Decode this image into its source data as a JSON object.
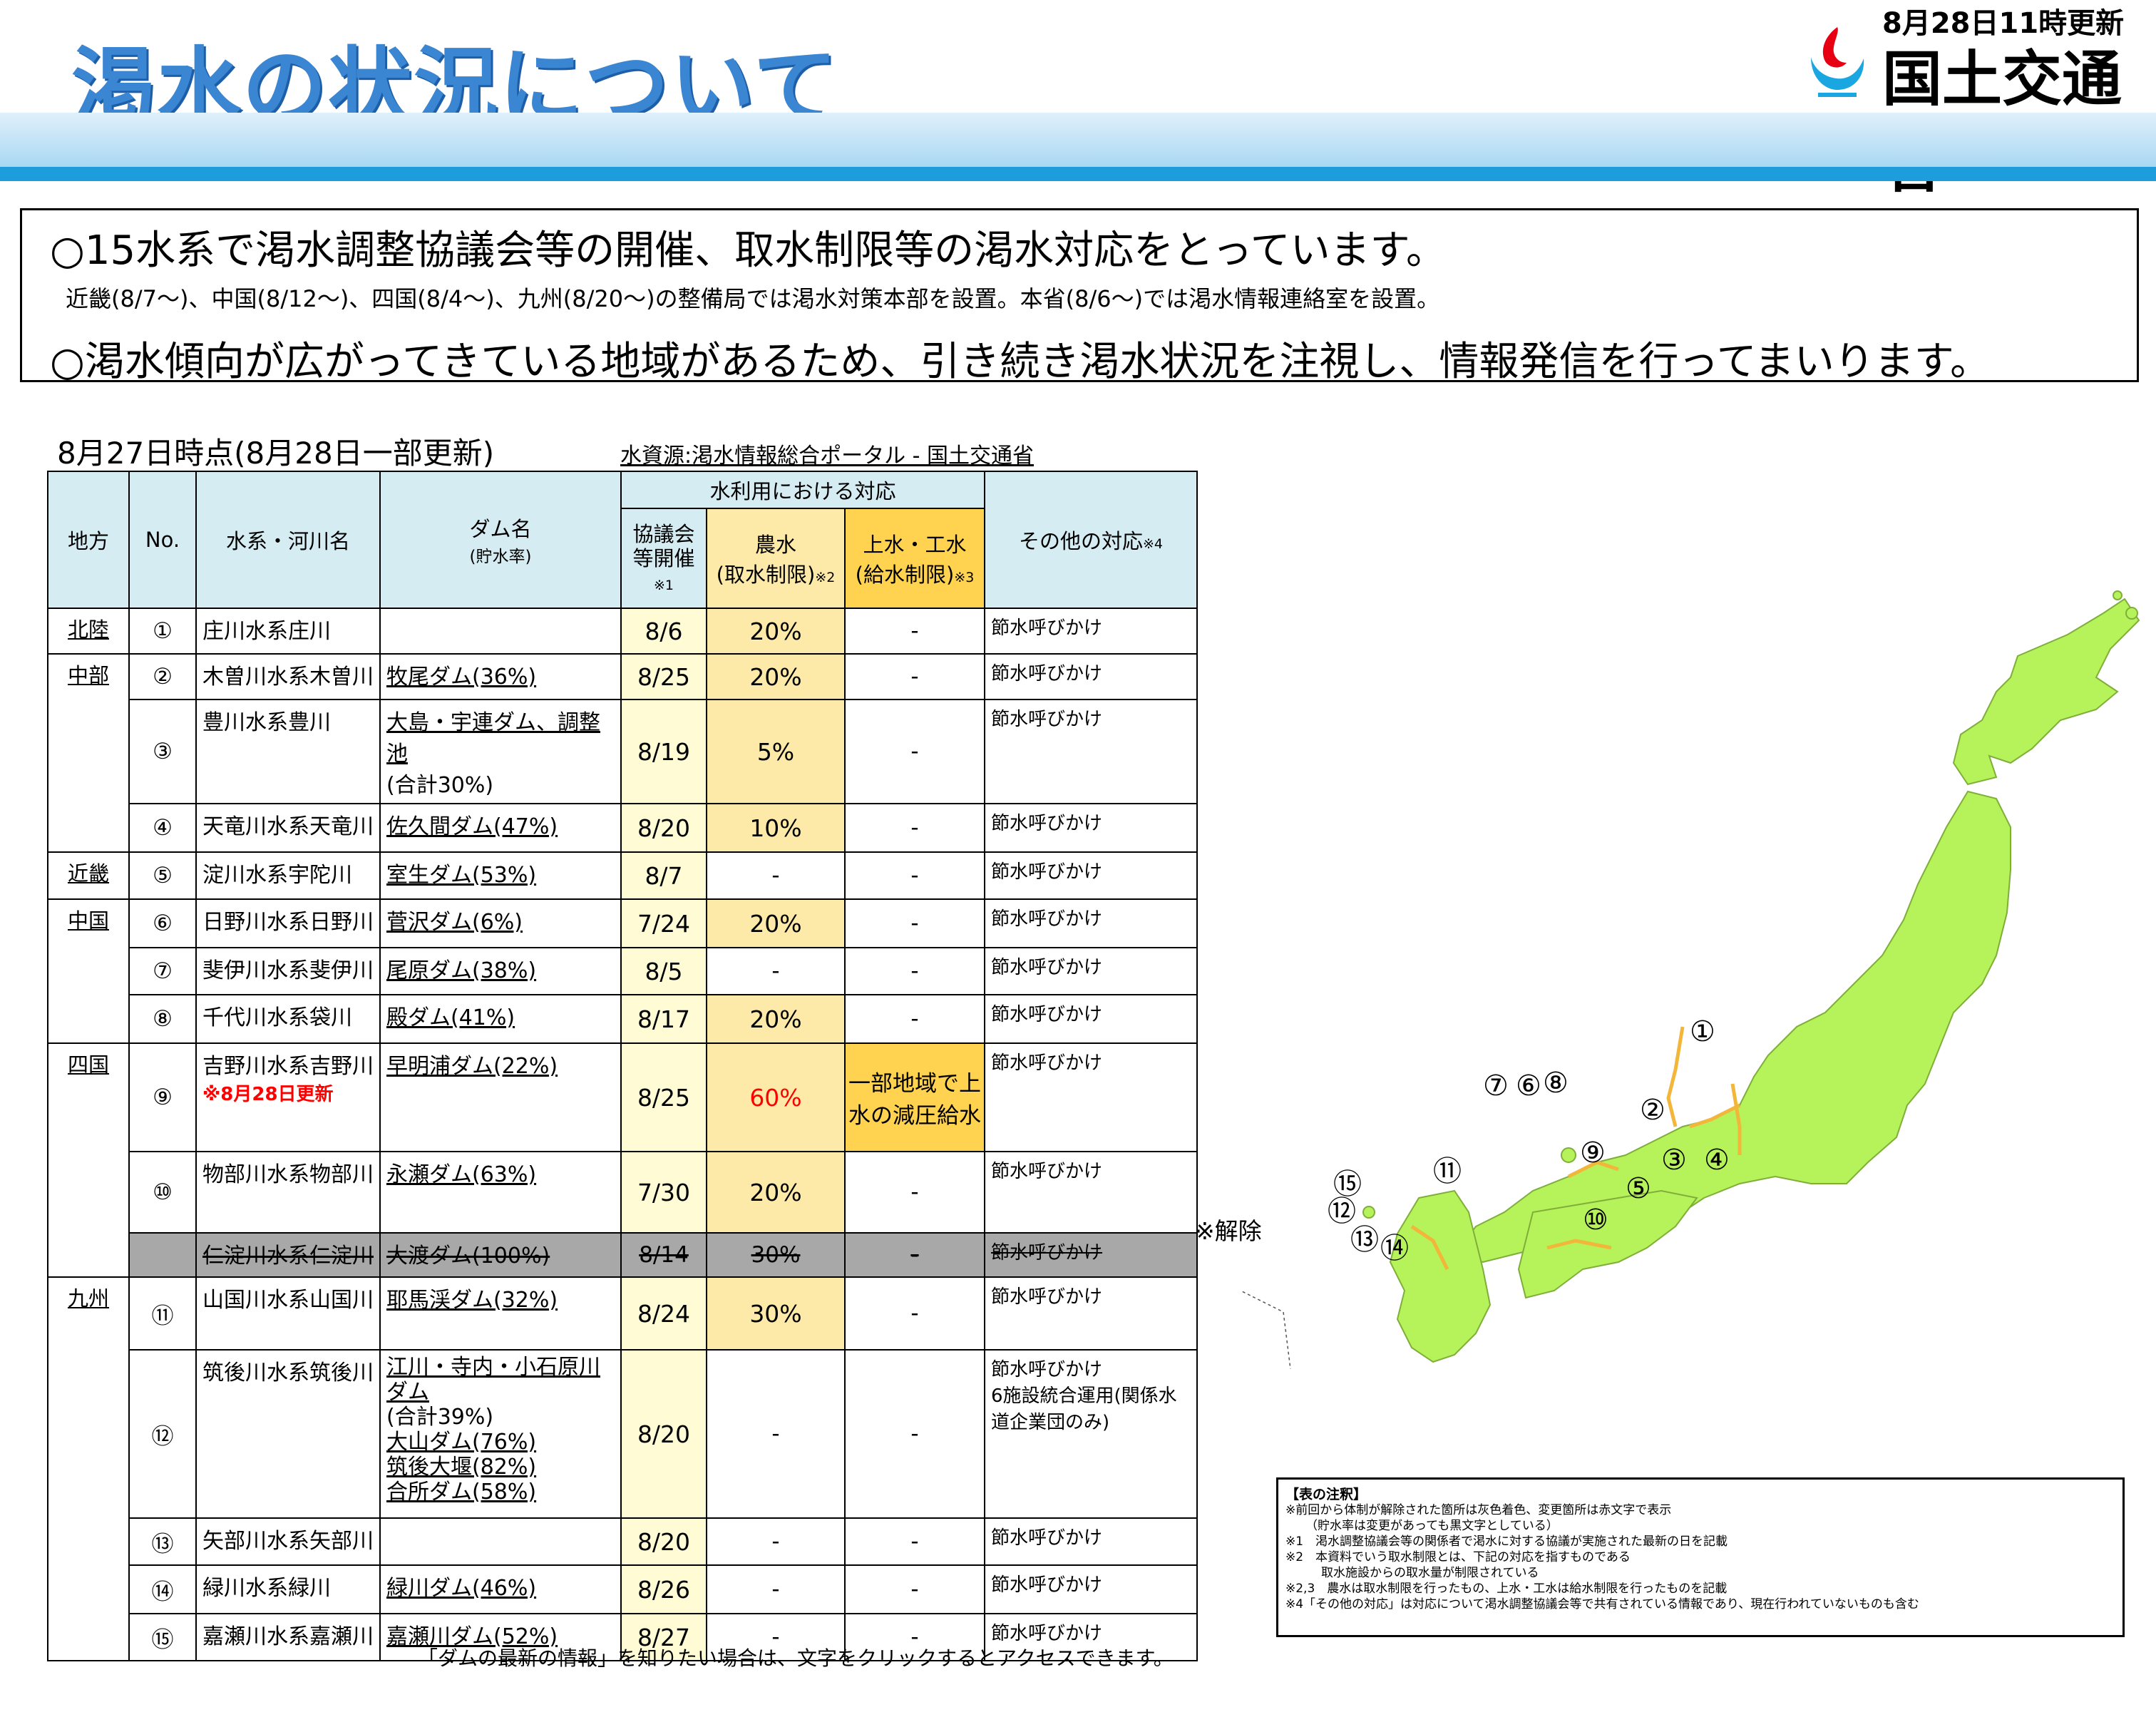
{
  "header": {
    "title": "渇水の状況について",
    "updated": "8月28日11時更新",
    "ministry": "国土交通省"
  },
  "summary": {
    "line1": "○15水系で渇水調整協議会等の開催、取水制限等の渇水対応をとっています。",
    "line2": "近畿(8/7〜)、中国(8/12〜)、四国(8/4〜)、九州(8/20〜)の整備局では渇水対策本部を設置。本省(8/6〜)では渇水情報連絡室を設置。",
    "line3": "○渇水傾向が広がってきている地域があるため、引き続き渇水状況を注視し、情報発信を行ってまいります。"
  },
  "as_of": "8月27日時点(8月28日一部更新)",
  "portal_link": "水資源:渇水情報総合ポータル - 国土交通省",
  "table": {
    "headers": {
      "region": "地方",
      "no": "No.",
      "river": "水系・河川名",
      "dam": "ダム名",
      "dam_sub": "(貯水率)",
      "water_use": "水利用における対応",
      "council": "協議会等開催",
      "council_mark": "※1",
      "agri": "農水",
      "agri_sub": "(取水制限)",
      "agri_mark": "※2",
      "supply": "上水・工水",
      "supply_sub": "(給水制限)",
      "supply_mark": "※3",
      "other": "その他の対応",
      "other_mark": "※4"
    },
    "regions": {
      "hokuriku": "北陸",
      "chubu": "中部",
      "kinki": "近畿",
      "chugoku": "中国",
      "shikoku": "四国",
      "kyushu": "九州"
    },
    "rows": [
      {
        "no": "①",
        "river": "庄川水系庄川",
        "dam": "",
        "council": "8/6",
        "agri": "20%",
        "supply": "-",
        "other": "節水呼びかけ"
      },
      {
        "no": "②",
        "river": "木曽川水系木曽川",
        "dam": "牧尾ダム(36%)",
        "council": "8/25",
        "agri": "20%",
        "supply": "-",
        "other": "節水呼びかけ"
      },
      {
        "no": "③",
        "river": "豊川水系豊川",
        "dam": "大島・宇連ダム、調整池",
        "dam2": "(合計30%)",
        "council": "8/19",
        "agri": "5%",
        "supply": "-",
        "other": "節水呼びかけ"
      },
      {
        "no": "④",
        "river": "天竜川水系天竜川",
        "dam": "佐久間ダム(47%)",
        "council": "8/20",
        "agri": "10%",
        "supply": "-",
        "other": "節水呼びかけ"
      },
      {
        "no": "⑤",
        "river": "淀川水系宇陀川",
        "dam": "室生ダム(53%)",
        "council": "8/7",
        "agri": "-",
        "supply": "-",
        "other": "節水呼びかけ"
      },
      {
        "no": "⑥",
        "river": "日野川水系日野川",
        "dam": "菅沢ダム(6%)",
        "council": "7/24",
        "agri": "20%",
        "supply": "-",
        "other": "節水呼びかけ"
      },
      {
        "no": "⑦",
        "river": "斐伊川水系斐伊川",
        "dam": "尾原ダム(38%)",
        "council": "8/5",
        "agri": "-",
        "supply": "-",
        "other": "節水呼びかけ"
      },
      {
        "no": "⑧",
        "river": "千代川水系袋川",
        "dam": "殿ダム(41%)",
        "council": "8/17",
        "agri": "20%",
        "supply": "-",
        "other": "節水呼びかけ"
      },
      {
        "no": "⑨",
        "river": "吉野川水系吉野川",
        "river_note": "※8月28日更新",
        "dam": "早明浦ダム(22%)",
        "council": "8/25",
        "agri": "60%",
        "supply": "一部地域で上水の減圧給水",
        "other": "節水呼びかけ"
      },
      {
        "no": "⑩",
        "river": "物部川水系物部川",
        "dam": "永瀬ダム(63%)",
        "council": "7/30",
        "agri": "20%",
        "supply": "-",
        "other": "節水呼びかけ"
      },
      {
        "no": "",
        "river": "仁淀川水系仁淀川",
        "dam": "大渡ダム(100%)",
        "council": "8/14",
        "agri": "30%",
        "supply": "-",
        "other": "節水呼びかけ"
      },
      {
        "no": "⑪",
        "river": "山国川水系山国川",
        "dam": "耶馬渓ダム(32%)",
        "council": "8/24",
        "agri": "30%",
        "supply": "-",
        "other": "節水呼びかけ"
      },
      {
        "no": "⑫",
        "river": "筑後川水系筑後川",
        "dam": "江川・寺内・小石原川ダム",
        "dam2": "(合計39%)",
        "dam3": "大山ダム(76%)",
        "dam4": "筑後大堰(82%)",
        "dam5": "合所ダム(58%)",
        "council": "8/20",
        "agri": "-",
        "supply": "-",
        "other": "節水呼びかけ",
        "other2": "6施設統合運用(関係水道企業団のみ)"
      },
      {
        "no": "⑬",
        "river": "矢部川水系矢部川",
        "dam": "",
        "council": "8/20",
        "agri": "-",
        "supply": "-",
        "other": "節水呼びかけ"
      },
      {
        "no": "⑭",
        "river": "緑川水系緑川",
        "dam": "緑川ダム(46%)",
        "council": "8/26",
        "agri": "-",
        "supply": "-",
        "other": "節水呼びかけ"
      },
      {
        "no": "⑮",
        "river": "嘉瀬川水系嘉瀬川",
        "dam": "嘉瀬川ダム(52%)",
        "council": "8/27",
        "agri": "-",
        "supply": "-",
        "other": "節水呼びかけ"
      }
    ]
  },
  "lifted_note": "※解除",
  "footer_note": "「ダムの最新の情報」を知りたい場合は、文字をクリックするとアクセスできます。",
  "notes": {
    "title": "【表の注釈】",
    "lines": [
      "※前回から体制が解除された箇所は灰色着色、変更箇所は赤文字で表示",
      "（貯水率は変更があっても黒文字としている）",
      "※1　渇水調整協議会等の関係者で渇水に対する協議が実施された最新の日を記載",
      "※2　本資料でいう取水制限とは、下記の対応を指すものである",
      "取水施設からの取水量が制限されている",
      "※2,3　農水は取水制限を行ったもの、上水・工水は給水制限を行ったものを記載",
      "※4「その他の対応」は対応について渇水調整協議会等で共有されている情報であり、現在行われていないものも含む"
    ]
  },
  "map": {
    "markers": [
      "①",
      "②",
      "③",
      "④",
      "⑤",
      "⑥",
      "⑦",
      "⑧",
      "⑨",
      "⑩",
      "⑪",
      "⑫",
      "⑬",
      "⑭",
      "⑮"
    ],
    "land_color": "#b6f25a",
    "river_color": "#f2b63a"
  },
  "colors": {
    "title": "#3b86d2",
    "header_cell": "#d6ecf3",
    "council_cell": "#fffbd5",
    "agri_cell": "#fde9a8",
    "supply_cell": "#ffd24f",
    "lifted_row": "#a8a8a8",
    "update_red": "#ff0000"
  }
}
